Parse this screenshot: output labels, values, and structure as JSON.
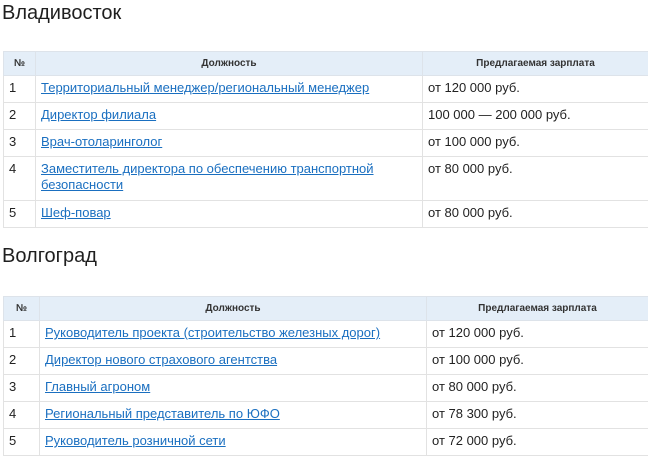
{
  "sections": [
    {
      "city": "Владивосток",
      "headers": {
        "num": "№",
        "position": "Должность",
        "salary": "Предлагаемая зарплата"
      },
      "rows": [
        {
          "num": "1",
          "position": "Территориальный менеджер/региональный менеджер",
          "salary": "от 120 000 руб."
        },
        {
          "num": "2",
          "position": "Директор филиала",
          "salary": "100 000 — 200 000 руб."
        },
        {
          "num": "3",
          "position": "Врач-отоларинголог",
          "salary": "от 100 000 руб."
        },
        {
          "num": "4",
          "position": "Заместитель директора по обеспечению транспортной безопасности",
          "salary": "от 80 000 руб."
        },
        {
          "num": "5",
          "position": "Шеф-повар",
          "salary": "от 80 000 руб."
        }
      ]
    },
    {
      "city": "Волгоград",
      "headers": {
        "num": "№",
        "position": "Должность",
        "salary": "Предлагаемая зарплата"
      },
      "rows": [
        {
          "num": "1",
          "position": "Руководитель проекта (строительство железных дорог)",
          "salary": "от 120 000 руб."
        },
        {
          "num": "2",
          "position": "Директор нового страхового агентства",
          "salary": "от 100 000 руб."
        },
        {
          "num": "3",
          "position": "Главный агроном",
          "salary": "от 80 000 руб."
        },
        {
          "num": "4",
          "position": "Региональный представитель по ЮФО",
          "salary": "от 78 300 руб."
        },
        {
          "num": "5",
          "position": "Руководитель розничной сети",
          "salary": "от 72 000 руб."
        }
      ]
    }
  ],
  "colors": {
    "link": "#1a6fc0",
    "header_bg": "#e4eef8",
    "border": "#e2e2e2"
  }
}
